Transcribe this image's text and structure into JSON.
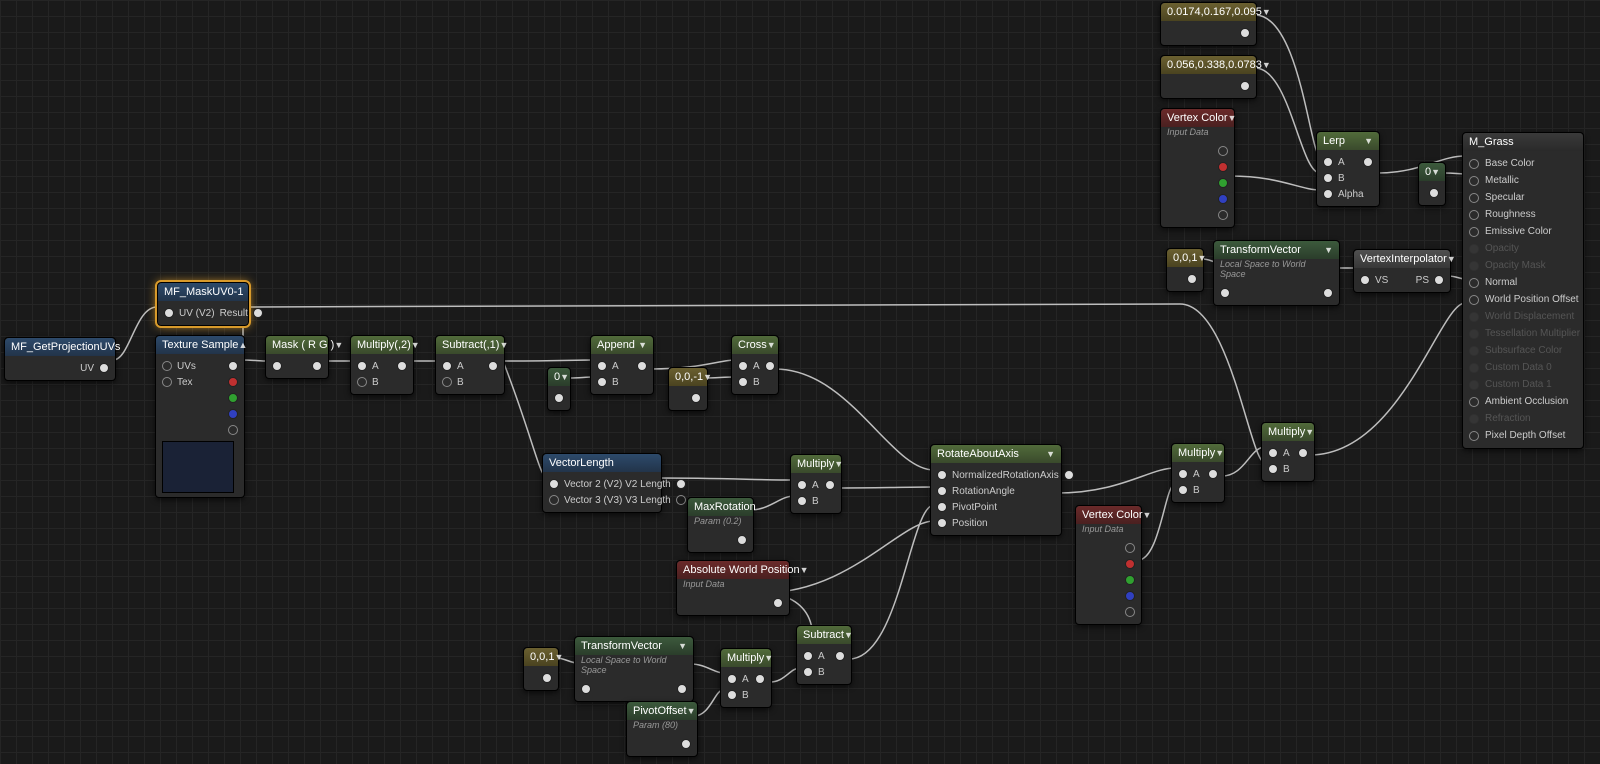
{
  "nodes": {
    "getProj": {
      "title": "MF_GetProjectionUVs",
      "out": "UV"
    },
    "maskUV": {
      "title": "MF_MaskUV0-1",
      "in": "UV (V2)",
      "out": "Result"
    },
    "texSample": {
      "title": "Texture Sample",
      "in0": "UVs",
      "in1": "Tex"
    },
    "mask": {
      "title": "Mask ( R G )"
    },
    "multiply2": {
      "title": "Multiply(,2)",
      "a": "A",
      "b": "B"
    },
    "subtract1": {
      "title": "Subtract(,1)",
      "a": "A",
      "b": "B"
    },
    "append": {
      "title": "Append",
      "a": "A",
      "b": "B"
    },
    "const0": {
      "title": "0"
    },
    "const001n": {
      "title": "0,0,-1"
    },
    "cross": {
      "title": "Cross",
      "a": "A",
      "b": "B"
    },
    "vecLen": {
      "title": "VectorLength",
      "r0": "Vector 2 (V2) V2 Length",
      "r1": "Vector 3 (V3) V3 Length"
    },
    "maxRot": {
      "title": "MaxRotation",
      "sub": "Param (0.2)"
    },
    "mulA": {
      "title": "Multiply",
      "a": "A",
      "b": "B"
    },
    "absWorld": {
      "title": "Absolute World Position",
      "sub": "Input Data"
    },
    "const001": {
      "title": "0,0,1"
    },
    "tVec1": {
      "title": "TransformVector",
      "sub": "Local Space to World Space"
    },
    "pivotOff": {
      "title": "PivotOffset",
      "sub": "Param (80)"
    },
    "mulB": {
      "title": "Multiply",
      "a": "A",
      "b": "B"
    },
    "subB": {
      "title": "Subtract",
      "a": "A",
      "b": "B"
    },
    "rotAxis": {
      "title": "RotateAboutAxis",
      "p0": "NormalizedRotationAxis",
      "p1": "RotationAngle",
      "p2": "PivotPoint",
      "p3": "Position"
    },
    "vcol2": {
      "title": "Vertex Color",
      "sub": "Input Data"
    },
    "mulC": {
      "title": "Multiply",
      "a": "A",
      "b": "B"
    },
    "mulD": {
      "title": "Multiply",
      "a": "A",
      "b": "B"
    },
    "colA": {
      "title": "0.0174,0.167,0.095"
    },
    "colB": {
      "title": "0.056,0.338,0.0783"
    },
    "vcol1": {
      "title": "Vertex Color",
      "sub": "Input Data"
    },
    "lerp": {
      "title": "Lerp",
      "a": "A",
      "b": "B",
      "c": "Alpha"
    },
    "mconst0": {
      "title": "0"
    },
    "const001b": {
      "title": "0,0,1"
    },
    "tVec2": {
      "title": "TransformVector",
      "sub": "Local Space to World Space"
    },
    "vInterp": {
      "title": "VertexInterpolator",
      "a": "VS",
      "b": "PS"
    }
  },
  "material": {
    "title": "M_Grass",
    "pins": [
      "Base Color",
      "Metallic",
      "Specular",
      "Roughness",
      "Emissive Color",
      "Opacity",
      "Opacity Mask",
      "Normal",
      "World Position Offset",
      "World Displacement",
      "Tessellation Multiplier",
      "Subsurface Color",
      "Custom Data 0",
      "Custom Data 1",
      "Ambient Occlusion",
      "Refraction",
      "Pixel Depth Offset"
    ],
    "enabled": [
      true,
      true,
      true,
      true,
      true,
      false,
      false,
      true,
      true,
      false,
      false,
      false,
      false,
      false,
      true,
      false,
      true
    ]
  }
}
